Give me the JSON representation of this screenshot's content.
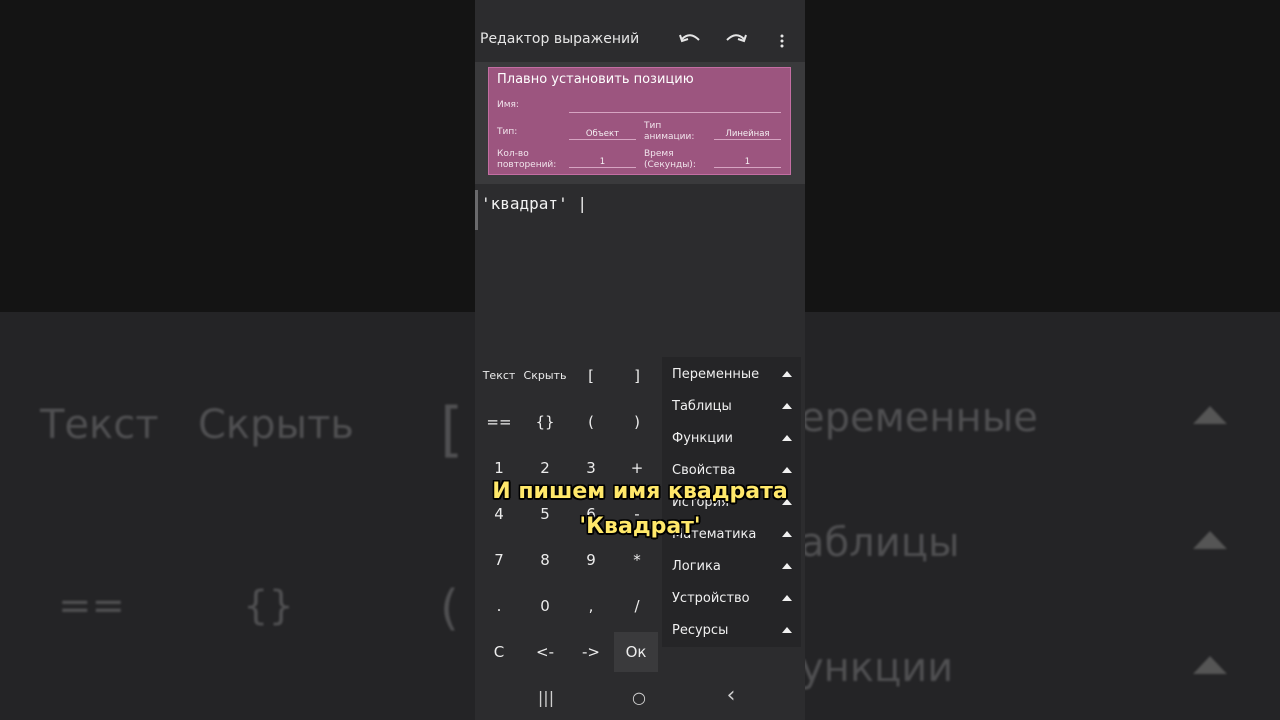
{
  "appbar": {
    "title": "Редактор выражений",
    "undo_icon": "undo-icon",
    "redo_icon": "redo-icon",
    "more_icon": "more-vert-icon"
  },
  "block": {
    "title": "Плавно установить позицию",
    "name_label": "Имя:",
    "name_value": "",
    "type_label": "Тип:",
    "type_value": "Объект",
    "anim_type_label_1": "Тип",
    "anim_type_label_2": "анимации:",
    "anim_type_value": "Линейная",
    "repeat_label_1": "Кол-во",
    "repeat_label_2": "повторений:",
    "repeat_value": "1",
    "time_label_1": "Время",
    "time_label_2": "(Секунды):",
    "time_value": "1",
    "color": "#9c557f"
  },
  "editor": {
    "code": "'квадрат' |"
  },
  "keyboard": {
    "text": "Текст",
    "hide": "Скрыть",
    "lbracket": "[",
    "rbracket": "]",
    "eq": "==",
    "braces": "{}",
    "lparen": "(",
    "rparen": ")",
    "k1": "1",
    "k2": "2",
    "k3": "3",
    "plus": "+",
    "k4": "4",
    "k5": "5",
    "k6": "6",
    "minus": "-",
    "k7": "7",
    "k8": "8",
    "k9": "9",
    "mul": "*",
    "dot": ".",
    "k0": "0",
    "comma": ",",
    "div": "/",
    "clear": "C",
    "left": "<-",
    "right": "->",
    "ok": "Ок"
  },
  "menu": {
    "items": [
      "Переменные",
      "Таблицы",
      "Функции",
      "Свойства",
      "История",
      "Математика",
      "Логика",
      "Устройство",
      "Ресурсы"
    ]
  },
  "navbar": {
    "recent": "|||",
    "home": "○",
    "back": "‹"
  },
  "subtitle": {
    "line1": "И пишем имя квадрата",
    "line2": "'Квадрат'"
  },
  "background": {
    "left_text": "Текст",
    "left_hide": "Скрыть",
    "left_bracket": "[",
    "left_eq": "==",
    "left_braces": "{}",
    "left_paren": "(",
    "right_vars": "еременные",
    "right_tables": "аблицы",
    "right_funcs": "ункции"
  }
}
